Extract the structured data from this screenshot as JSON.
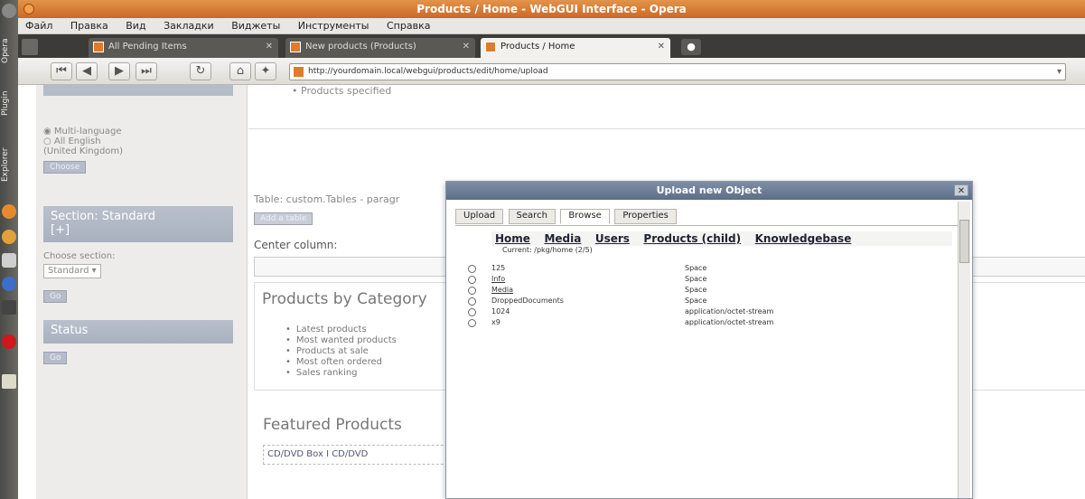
{
  "window": {
    "title": "Products / Home - WebGUI Interface - Opera"
  },
  "dock": {
    "labels": [
      "Opera",
      "Plugin",
      "Explorer"
    ]
  },
  "menubar": {
    "items": [
      "Файл",
      "Правка",
      "Вид",
      "Закладки",
      "Виджеты",
      "Инструменты",
      "Справка"
    ]
  },
  "tabs": [
    {
      "label": "All Pending Items",
      "active": false
    },
    {
      "label": "New products (Products)",
      "active": false
    },
    {
      "label": "Products / Home",
      "active": true
    }
  ],
  "navbar": {
    "url": "http://yourdomain.local/webgui/products/edit/home/upload",
    "go": "▾"
  },
  "left": {
    "radio1": "Multi-language",
    "radio2": "All English",
    "radio3": "(United Kingdom)",
    "btn1": "Choose",
    "section_header": "Section: Standard",
    "section_sub": "[+]",
    "choose_section": "Choose section:",
    "select_value": "Standard",
    "btn2": "Go",
    "status_header": "Status",
    "btn3": "Go"
  },
  "main": {
    "top_item": "Products specified",
    "table_line": "Table: custom.Tables - paragr",
    "btn": "Add a table",
    "center_column": "Center column:",
    "heading1": "Products by Category",
    "list": [
      "Latest products",
      "Most wanted products",
      "Products at sale",
      "Most often ordered",
      "Sales ranking"
    ],
    "heading2": "Featured Products",
    "featured": "CD/DVD Box I  CD/DVD"
  },
  "dialog": {
    "title": "Upload new Object",
    "close": "✕",
    "tabs": [
      "Upload",
      "Search",
      "Browse",
      "Properties"
    ],
    "crumbs": [
      "Home",
      "Media",
      "Users",
      "Products (child)",
      "Knowledgebase"
    ],
    "current_path": "Current: /pkg/home (2/5)",
    "rows": [
      {
        "name": "125",
        "type": "Space"
      },
      {
        "name": "Info",
        "type": "Space"
      },
      {
        "name": "Media",
        "type": "Space"
      },
      {
        "name": "DroppedDocuments",
        "type": "Space"
      },
      {
        "name": "1024",
        "type": "application/octet-stream"
      },
      {
        "name": "x9",
        "type": "application/octet-stream"
      }
    ]
  }
}
